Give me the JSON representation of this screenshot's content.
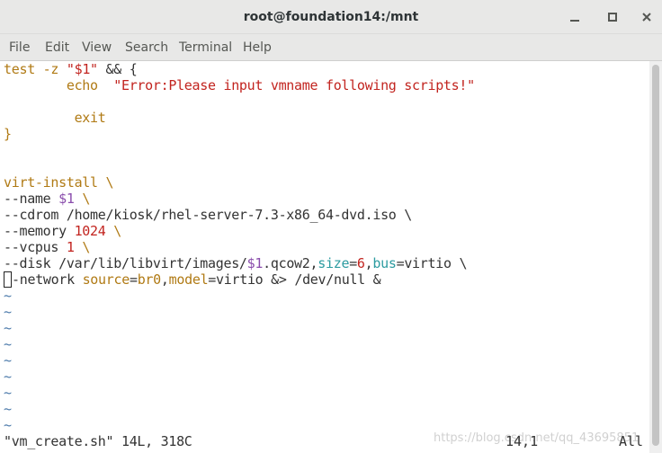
{
  "window": {
    "title": "root@foundation14:/mnt"
  },
  "menu": {
    "file": "File",
    "edit": "Edit",
    "view": "View",
    "search": "Search",
    "terminal": "Terminal",
    "help": "Help"
  },
  "editor": {
    "l1_a": "test -z ",
    "l1_b": "\"$1\"",
    "l1_c": " && {",
    "l2_a": "        echo  ",
    "l2_b": "\"Error:Please input vmname following scripts!\"",
    "l4_a": "         exit",
    "l5_a": "}",
    "l8_a": "virt-install \\",
    "l9_a": "--name ",
    "l9_b": "$1",
    "l9_c": " \\",
    "l10_a": "--cdrom /home/kiosk/rhel-server-7.3-x86_64-dvd.iso \\",
    "l11_a": "--memory ",
    "l11_b": "1024",
    "l11_c": " \\",
    "l12_a": "--vcpus ",
    "l12_b": "1",
    "l12_c": " \\",
    "l13_a": "--disk /var/lib/libvirt/images/",
    "l13_b": "$1",
    "l13_c": ".qcow2,",
    "l13_d": "size",
    "l13_e": "=",
    "l13_f": "6",
    "l13_g": ",",
    "l13_h": "bus",
    "l13_i": "=virtio \\",
    "l14_cursor": "-",
    "l14_a": "-network ",
    "l14_b": "source",
    "l14_c": "=",
    "l14_d": "br0",
    "l14_e": ",",
    "l14_f": "model",
    "l14_g": "=virtio &> /dev/null &",
    "tilde": "~"
  },
  "statusline": {
    "file_info": "\"vm_create.sh\" 14L, 318C",
    "position": "14,1",
    "scroll": "All"
  },
  "watermark": "https://blog.csdn.net/qq_43695851",
  "colors": {
    "keyword": "#b07a14",
    "string": "#c2241f",
    "variable": "#8a4dac",
    "attribute": "#2c9ba0",
    "tilde": "#4c7aab"
  }
}
